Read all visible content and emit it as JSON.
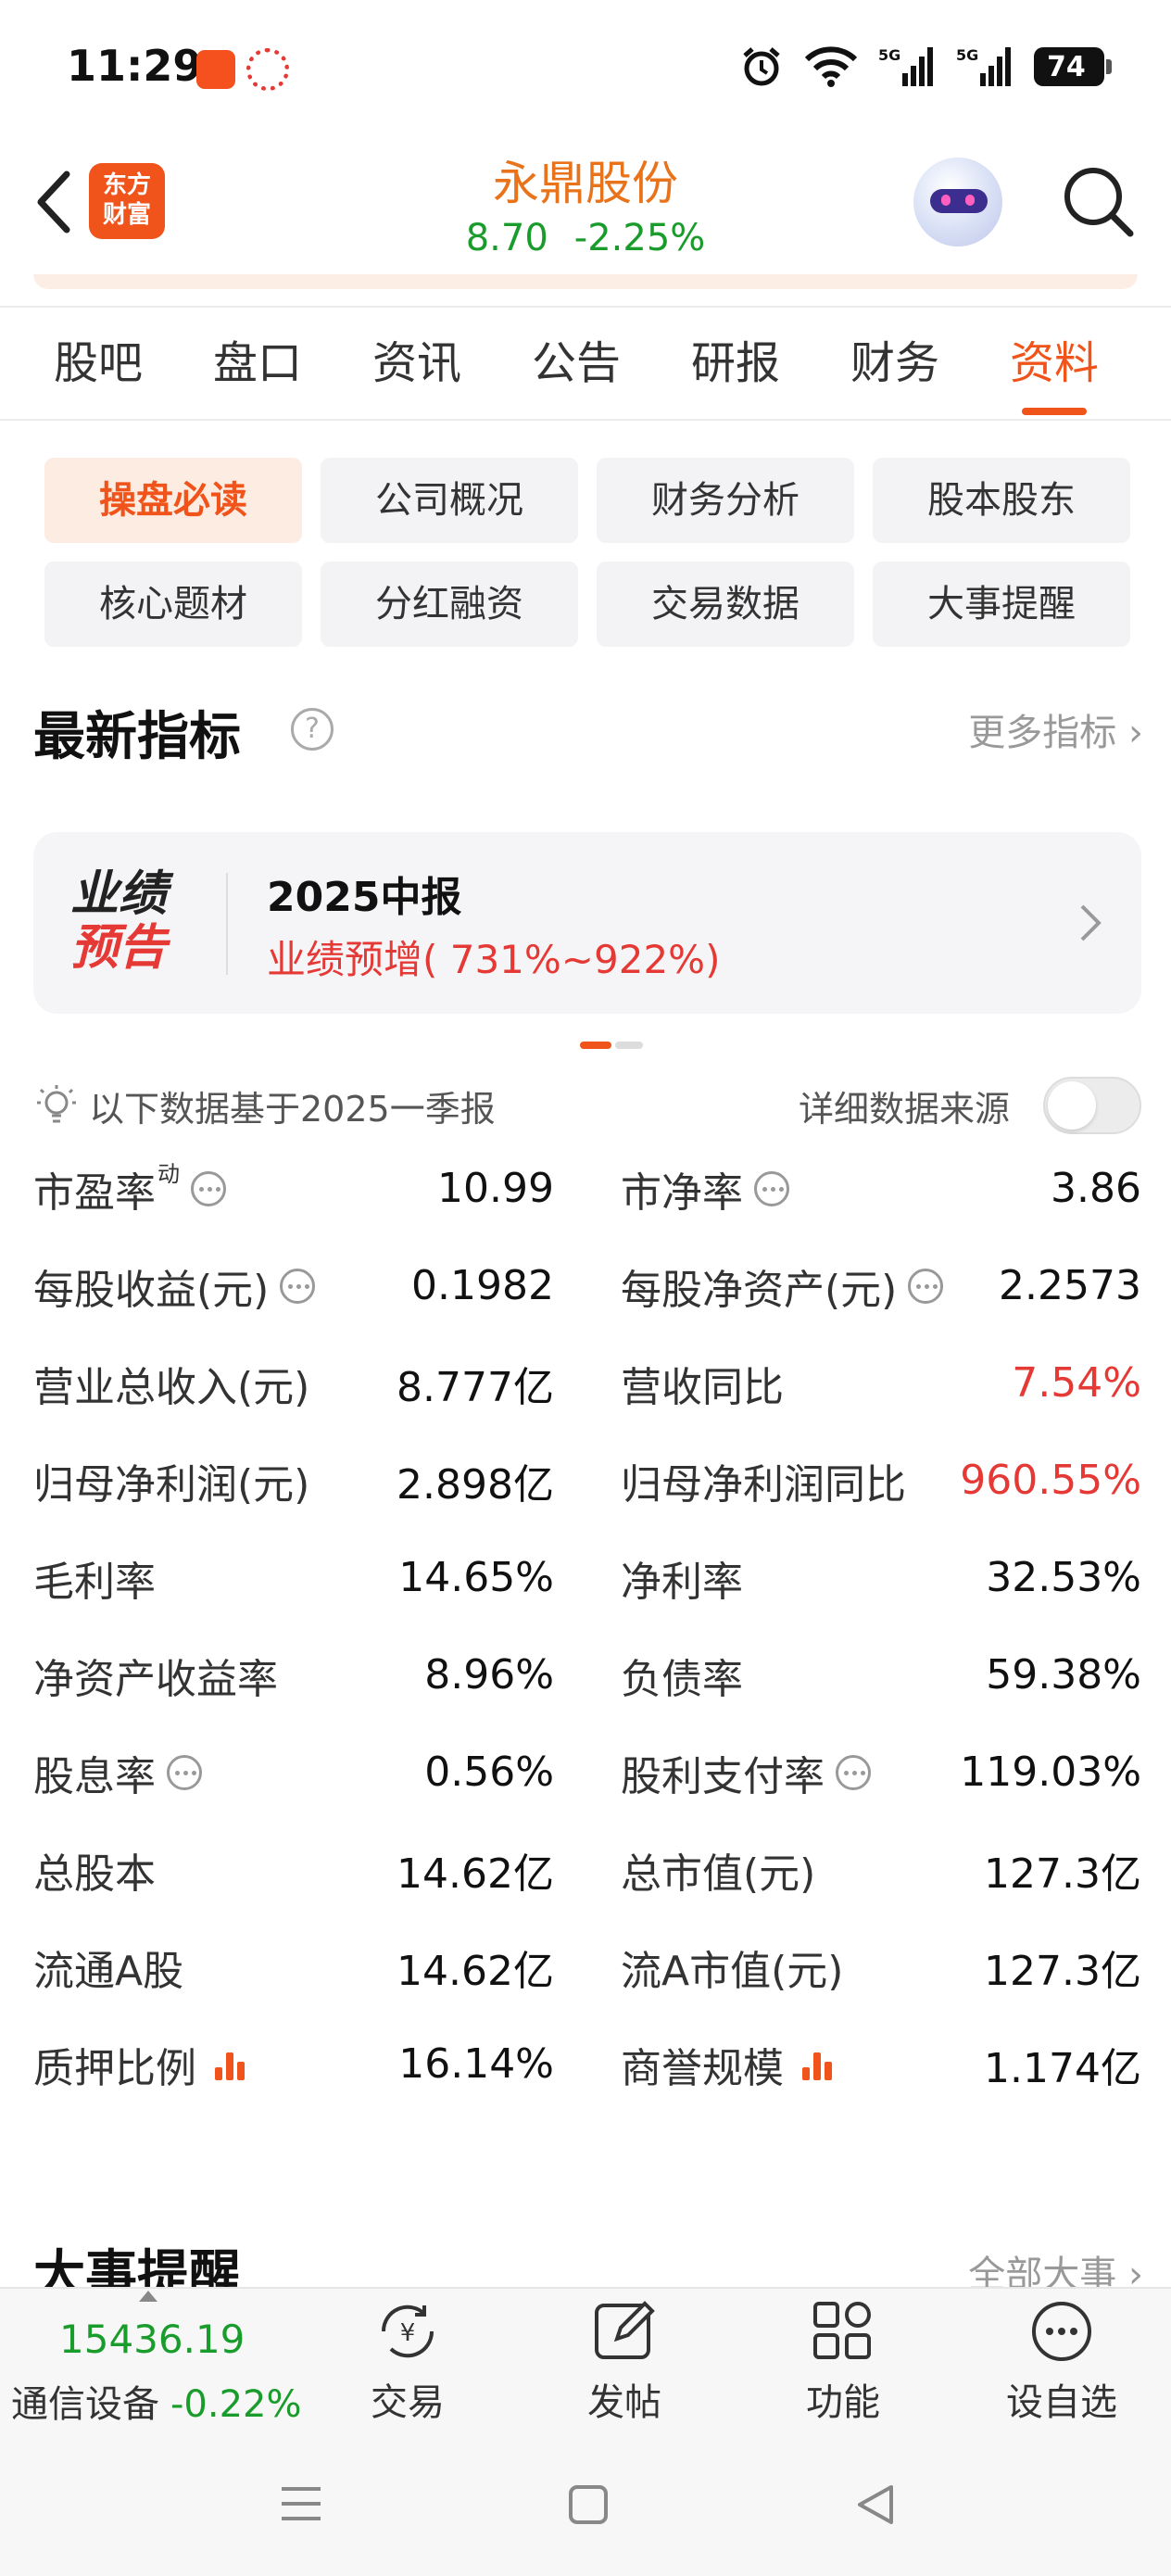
{
  "status_bar": {
    "time": "11:29",
    "battery": "74",
    "icons": [
      "alarm-icon",
      "wifi-icon",
      "signal-5g-icon",
      "signal-5g-icon",
      "battery-icon"
    ]
  },
  "header": {
    "logo_line1": "东方",
    "logo_line2": "财富",
    "stock_name": "永鼎股份",
    "price": "8.70",
    "change_pct": "-2.25%"
  },
  "tabs": [
    {
      "label": "股吧",
      "active": false
    },
    {
      "label": "盘口",
      "active": false
    },
    {
      "label": "资讯",
      "active": false
    },
    {
      "label": "公告",
      "active": false
    },
    {
      "label": "研报",
      "active": false
    },
    {
      "label": "财务",
      "active": false
    },
    {
      "label": "资料",
      "active": true
    }
  ],
  "submenu": [
    {
      "label": "操盘必读",
      "active": true
    },
    {
      "label": "公司概况",
      "active": false
    },
    {
      "label": "财务分析",
      "active": false
    },
    {
      "label": "股本股东",
      "active": false
    },
    {
      "label": "核心题材",
      "active": false
    },
    {
      "label": "分红融资",
      "active": false
    },
    {
      "label": "交易数据",
      "active": false
    },
    {
      "label": "大事提醒",
      "active": false
    }
  ],
  "latest": {
    "title": "最新指标",
    "more": "更多指标"
  },
  "forecast": {
    "badge_line1": "业绩",
    "badge_line2": "预告",
    "period": "2025中报",
    "desc": "业绩预增( 731%~922%)"
  },
  "basis": {
    "text": "以下数据基于2025一季报",
    "source_label": "详细数据来源",
    "source_toggle_on": false
  },
  "metrics": [
    {
      "left": {
        "label": "市盈率",
        "sup": "动",
        "icon": "info",
        "value": "10.99",
        "red": false
      },
      "right": {
        "label": "市净率",
        "icon": "info",
        "value": "3.86",
        "red": false
      }
    },
    {
      "left": {
        "label": "每股收益(元)",
        "icon": "info",
        "value": "0.1982",
        "red": false
      },
      "right": {
        "label": "每股净资产(元)",
        "icon": "info",
        "value": "2.2573",
        "red": false
      }
    },
    {
      "left": {
        "label": "营业总收入(元)",
        "value": "8.777亿",
        "red": false
      },
      "right": {
        "label": "营收同比",
        "value": "7.54%",
        "red": true
      }
    },
    {
      "left": {
        "label": "归母净利润(元)",
        "value": "2.898亿",
        "red": false
      },
      "right": {
        "label": "归母净利润同比",
        "value": "960.55%",
        "red": true
      }
    },
    {
      "left": {
        "label": "毛利率",
        "value": "14.65%",
        "red": false
      },
      "right": {
        "label": "净利率",
        "value": "32.53%",
        "red": false
      }
    },
    {
      "left": {
        "label": "净资产收益率",
        "value": "8.96%",
        "red": false
      },
      "right": {
        "label": "负债率",
        "value": "59.38%",
        "red": false
      }
    },
    {
      "left": {
        "label": "股息率",
        "icon": "info",
        "value": "0.56%",
        "red": false
      },
      "right": {
        "label": "股利支付率",
        "icon": "info",
        "value": "119.03%",
        "red": false
      }
    },
    {
      "left": {
        "label": "总股本",
        "value": "14.62亿",
        "red": false
      },
      "right": {
        "label": "总市值(元)",
        "value": "127.3亿",
        "red": false
      }
    },
    {
      "left": {
        "label": "流通A股",
        "value": "14.62亿",
        "red": false
      },
      "right": {
        "label": "流A市值(元)",
        "value": "127.3亿",
        "red": false
      }
    },
    {
      "left": {
        "label": "质押比例",
        "icon": "chart",
        "value": "16.14%",
        "red": false
      },
      "right": {
        "label": "商誉规模",
        "icon": "chart",
        "value": "1.174亿",
        "red": false
      }
    }
  ],
  "next_section": {
    "title": "大事提醒",
    "more": "全部大事"
  },
  "toolbar": {
    "index_value": "15436.19",
    "index_name": "通信设备",
    "index_change": "-0.22%",
    "trade": "交易",
    "post": "发帖",
    "function": "功能",
    "watchlist": "设自选"
  },
  "colors": {
    "accent": "#f0541a",
    "up": "#e53935",
    "down": "#1a9c2c",
    "stock_name": "#e8731a"
  }
}
